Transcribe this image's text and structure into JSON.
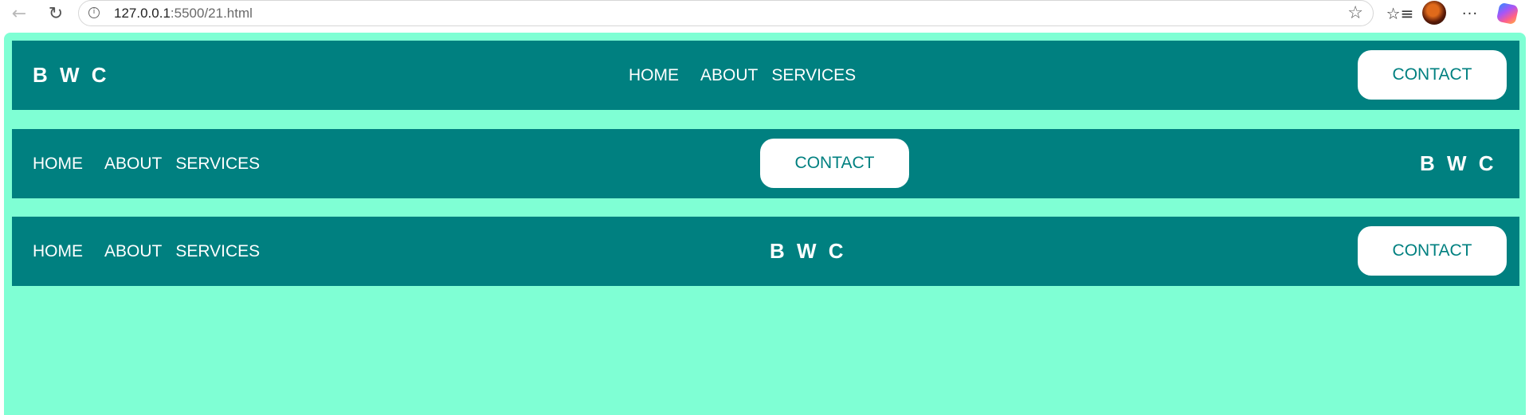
{
  "browser": {
    "url_host": "127.0.0.1",
    "url_rest": ":5500/21.html",
    "icons": {
      "back": "arrow-left-icon",
      "reload": "reload-icon",
      "info": "info-icon",
      "favorite": "star-icon",
      "favorites_list": "favorites-list-icon",
      "profile": "profile-avatar",
      "more": "more-icon",
      "copilot": "copilot-icon"
    }
  },
  "colors": {
    "page_background": "#7fffd4",
    "navbar_background": "#008080",
    "text": "#ffffff",
    "button_background": "#ffffff",
    "button_text": "#008080"
  },
  "navbars": [
    {
      "logo": "B W C",
      "links": [
        "HOME",
        "ABOUT",
        "SERVICES"
      ],
      "contact": "CONTACT"
    },
    {
      "logo": "B W C",
      "links": [
        "HOME",
        "ABOUT",
        "SERVICES"
      ],
      "contact": "CONTACT"
    },
    {
      "logo": "B W C",
      "links": [
        "HOME",
        "ABOUT",
        "SERVICES"
      ],
      "contact": "CONTACT"
    }
  ]
}
